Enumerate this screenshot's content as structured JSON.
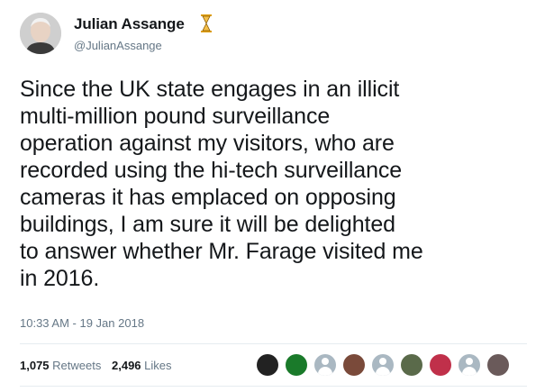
{
  "author": {
    "display_name": "Julian Assange",
    "handle": "@JulianAssange",
    "badge_icon": "hourglass-icon"
  },
  "tweet": {
    "text": "Since the UK state engages in an illicit\nmulti-million pound surveillance\noperation against my visitors, who are\nrecorded using the hi-tech surveillance\ncameras it has emplaced on opposing\nbuildings, I am sure it will be delighted\nto answer whether Mr. Farage visited me\nin 2016.",
    "timestamp": "10:33 AM - 19 Jan 2018"
  },
  "stats": {
    "retweets_count": "1,075",
    "retweets_label": "Retweets",
    "likes_count": "2,496",
    "likes_label": "Likes"
  },
  "likers": [
    {
      "name": "liker-avatar-1",
      "color": "#222222"
    },
    {
      "name": "liker-avatar-2",
      "color": "#1a7a2a"
    },
    {
      "name": "liker-avatar-3",
      "color": "#aab8c2"
    },
    {
      "name": "liker-avatar-4",
      "color": "#7a4a3a"
    },
    {
      "name": "liker-avatar-5",
      "color": "#aab8c2"
    },
    {
      "name": "liker-avatar-6",
      "color": "#5a6a4a"
    },
    {
      "name": "liker-avatar-7",
      "color": "#c0304a"
    },
    {
      "name": "liker-avatar-8",
      "color": "#aab8c2"
    },
    {
      "name": "liker-avatar-9",
      "color": "#6a5a5a"
    }
  ],
  "colors": {
    "text": "#14171a",
    "secondary": "#657786",
    "divider": "#e6ecf0"
  }
}
